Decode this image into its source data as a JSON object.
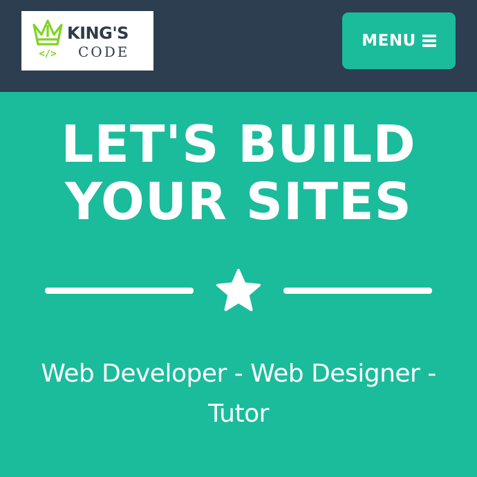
{
  "navbar": {
    "logo": {
      "kings_text": "KING'S",
      "code_text": "CODE",
      "code_symbol": "</>",
      "icon": "crown-icon",
      "accent_color": "#7ed321"
    },
    "menu": {
      "label": "MENU",
      "icon": "hamburger-icon"
    }
  },
  "hero": {
    "title_line1": "LET'S BUILD",
    "title_line2": "YOUR SITES",
    "divider_icon": "star-icon",
    "subtitle_line1": "Web Developer - Web Designer -",
    "subtitle_line2": "Tutor"
  },
  "colors": {
    "navbar_bg": "#2c3e50",
    "primary": "#1abc9c",
    "text": "#ffffff"
  }
}
